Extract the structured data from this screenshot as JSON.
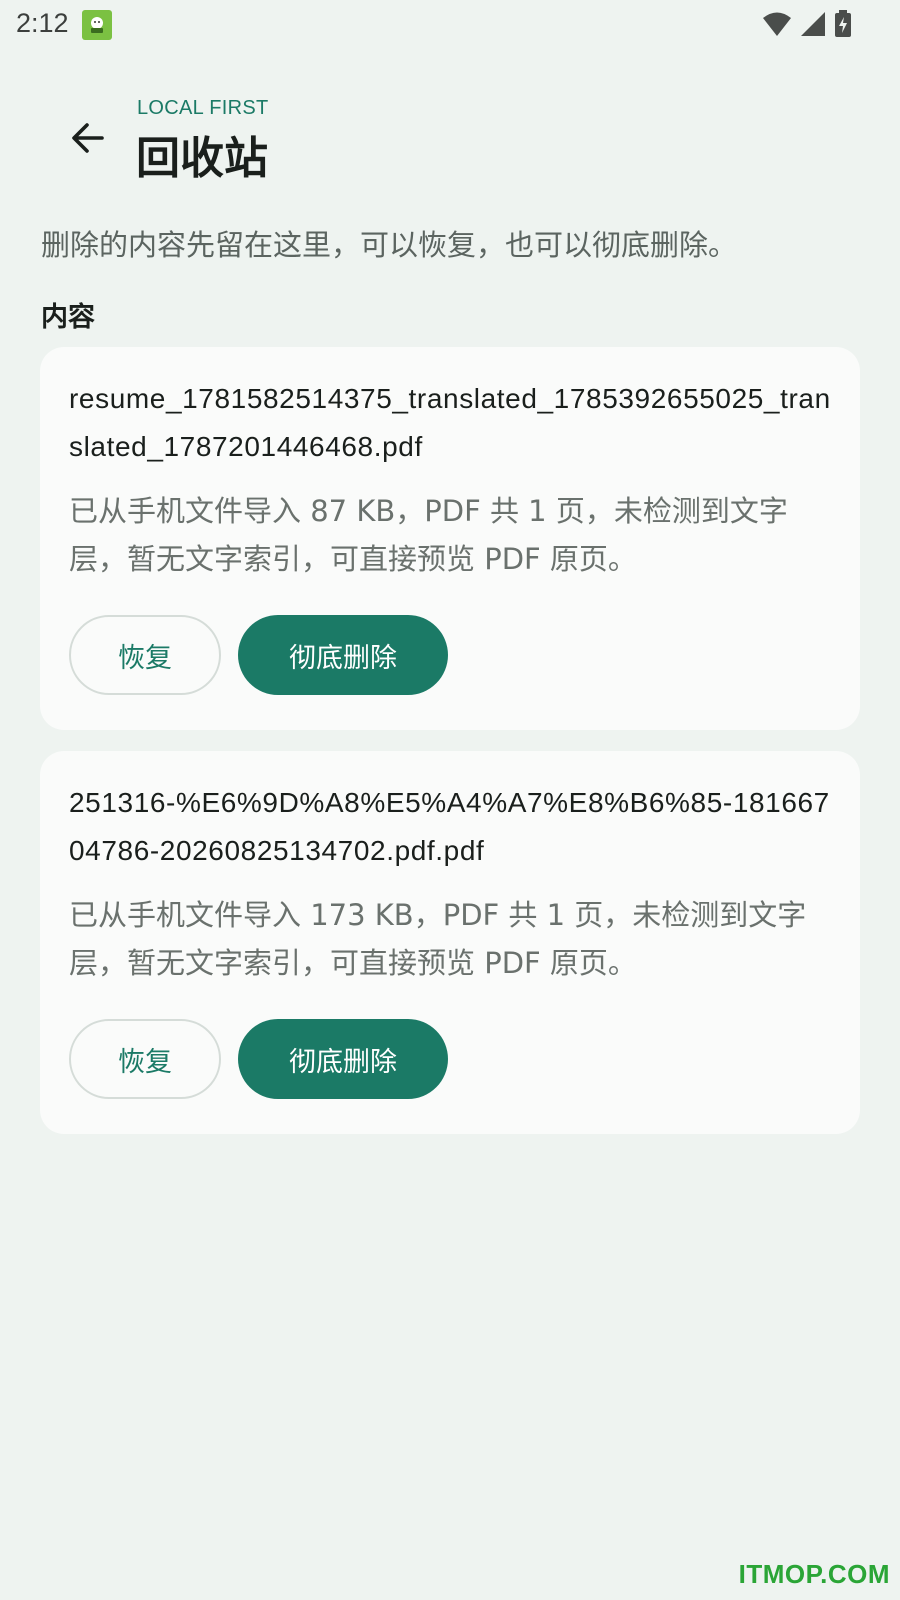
{
  "status_bar": {
    "time": "2:12",
    "icons": [
      "app-notification-icon",
      "wifi-icon",
      "signal-icon",
      "battery-charging-icon"
    ]
  },
  "header": {
    "eyebrow": "LOCAL FIRST",
    "title": "回收站",
    "back_icon": "arrow-left-icon"
  },
  "description": "删除的内容先留在这里，可以恢复，也可以彻底删除。",
  "section_label": "内容",
  "items": [
    {
      "title": "resume_1781582514375_translated_1785392655025_translated_1787201446468.pdf",
      "meta": "已从手机文件导入 87 KB，PDF 共 1 页，未检测到文字层，暂无文字索引，可直接预览 PDF 原页。",
      "restore_label": "恢复",
      "delete_label": "彻底删除"
    },
    {
      "title": "251316-%E6%9D%A8%E5%A4%A7%E8%B6%85-18166704786-20260825134702.pdf.pdf",
      "meta": "已从手机文件导入 173 KB，PDF 共 1 页，未检测到文字层，暂无文字索引，可直接预览 PDF 原页。",
      "restore_label": "恢复",
      "delete_label": "彻底删除"
    }
  ],
  "watermark": "ITMOP.COM",
  "colors": {
    "accent": "#1b7a66",
    "background": "#eef3f0",
    "card": "#fafbfa"
  }
}
